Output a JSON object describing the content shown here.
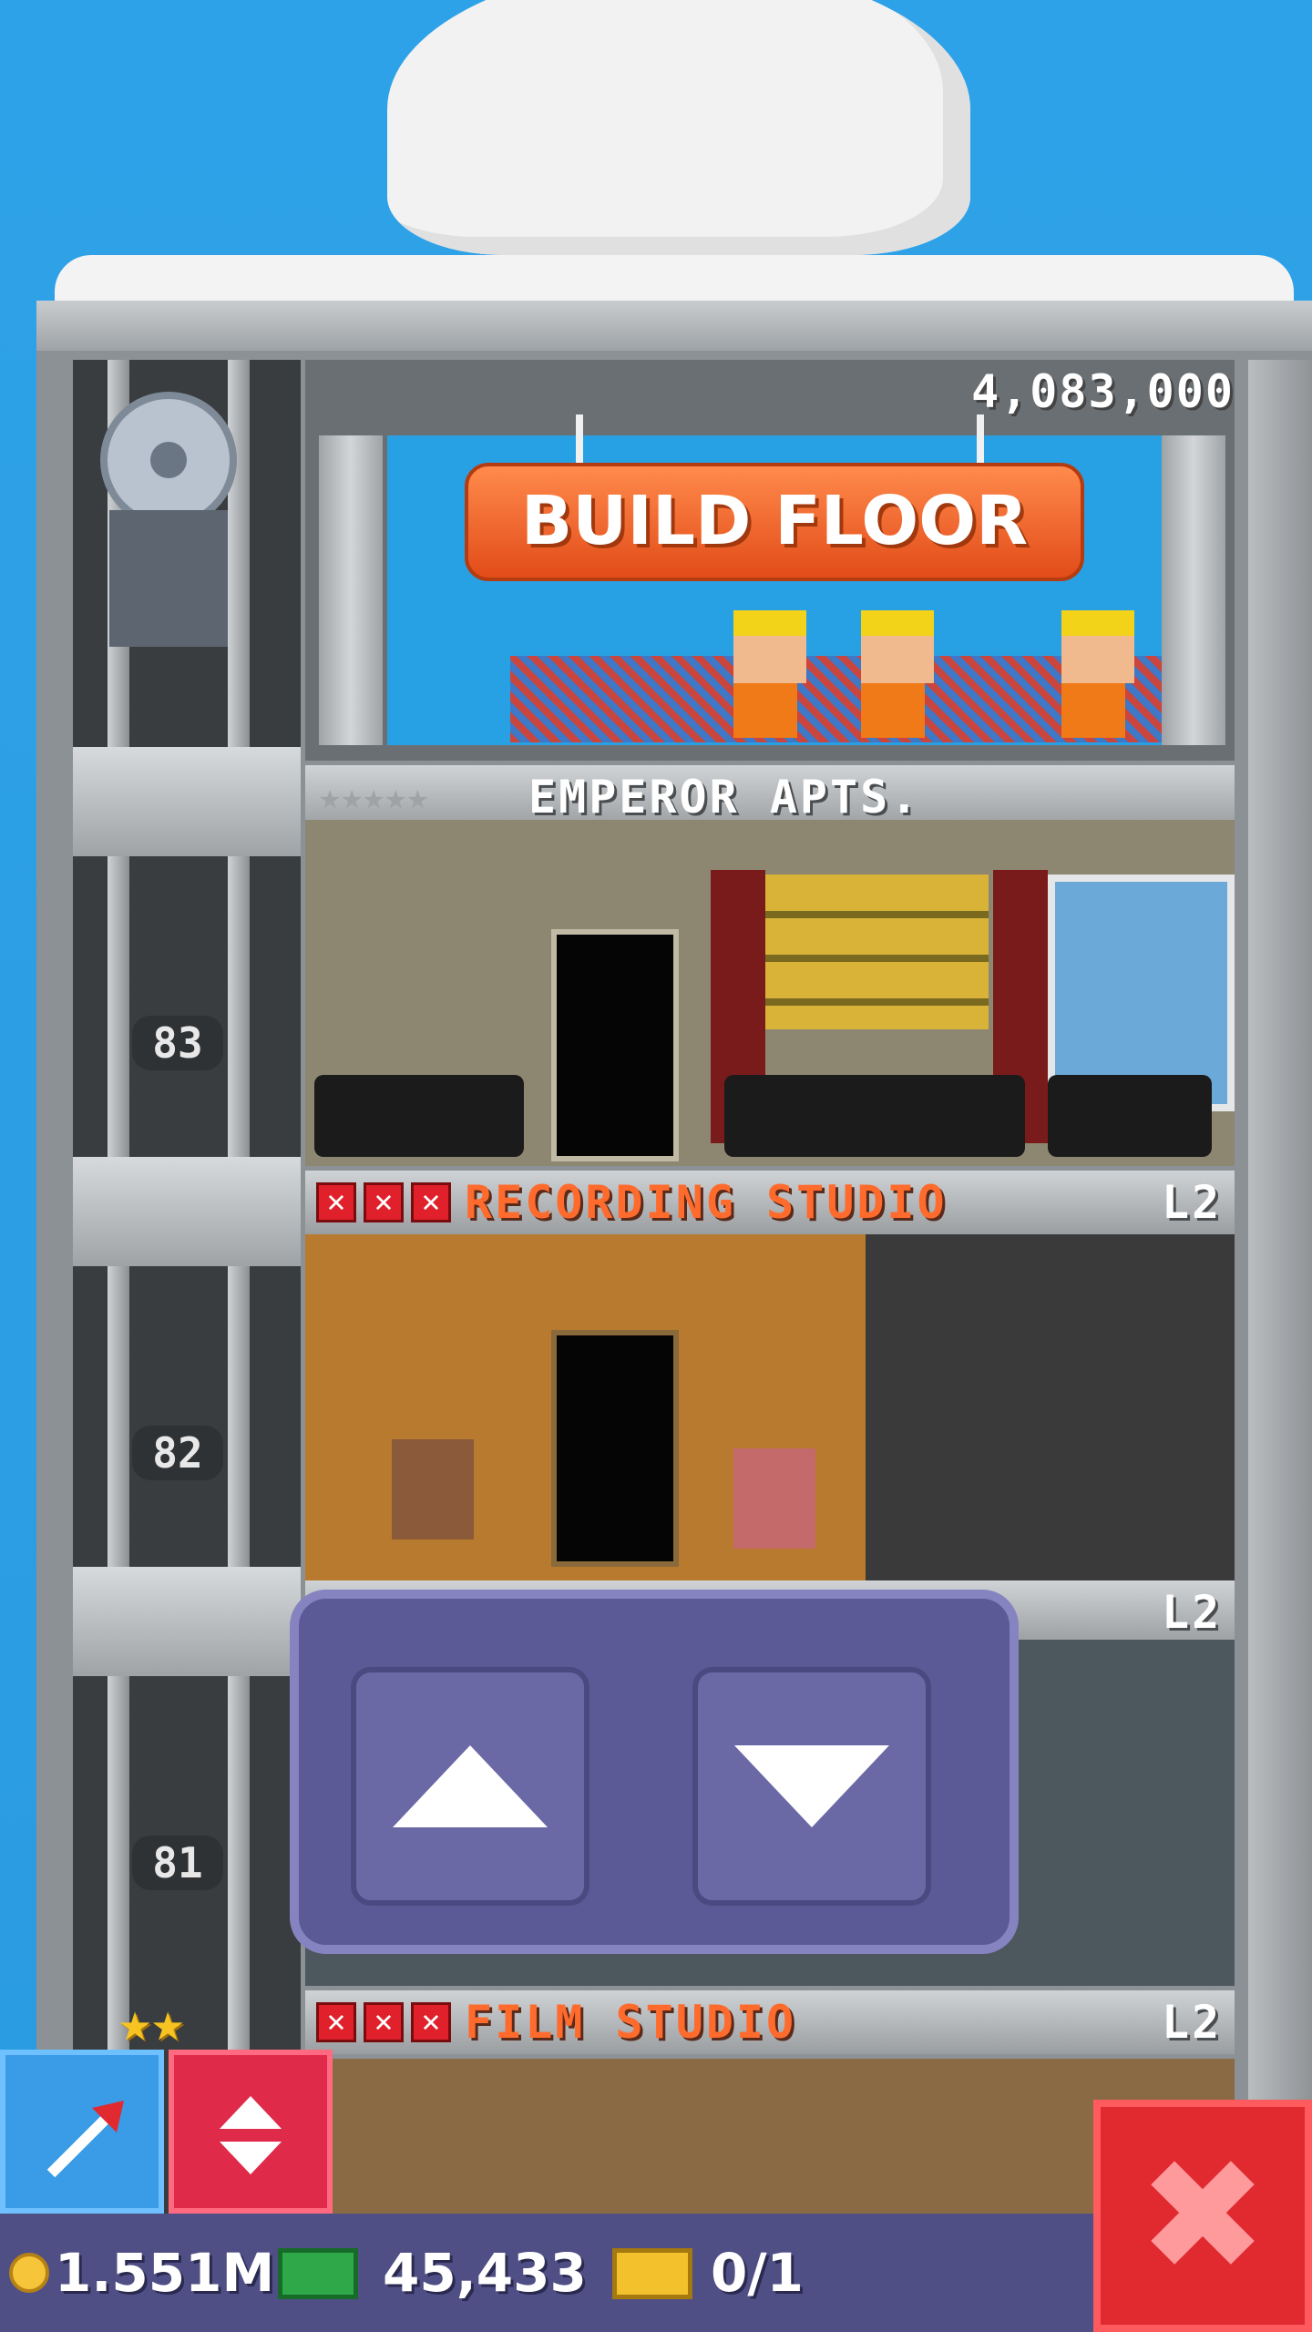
{
  "construction": {
    "price": "4,083,000",
    "build_button_label": "BUILD FLOOR"
  },
  "floors": [
    {
      "name": "EMPEROR APTS.",
      "stars": "★★★★★",
      "level": ""
    },
    {
      "name": "RECORDING STUDIO",
      "level": "L2",
      "elevator_floor": "83"
    },
    {
      "name": "",
      "level": "L2",
      "elevator_floor": "82"
    },
    {
      "name": "FILM STUDIO",
      "level": "L2",
      "elevator_floor": "81"
    }
  ],
  "elevator_controls": {
    "up_icon": "up-arrow-icon",
    "down_icon": "down-arrow-icon"
  },
  "elevator_stars": "★★",
  "toolbar": {
    "move_icon": "arrow-tool-icon",
    "elevator_icon": "elevator-updown-icon",
    "close_icon": "close-icon",
    "close_glyph": "✖"
  },
  "status": {
    "coins": "1.551M",
    "bux": "45,433",
    "tickets": "0/1"
  },
  "colors": {
    "build_button": "#f05a22",
    "panel": "#5b5a96",
    "close_button": "#e02a30",
    "bottom_bar": "#4f4f86"
  }
}
